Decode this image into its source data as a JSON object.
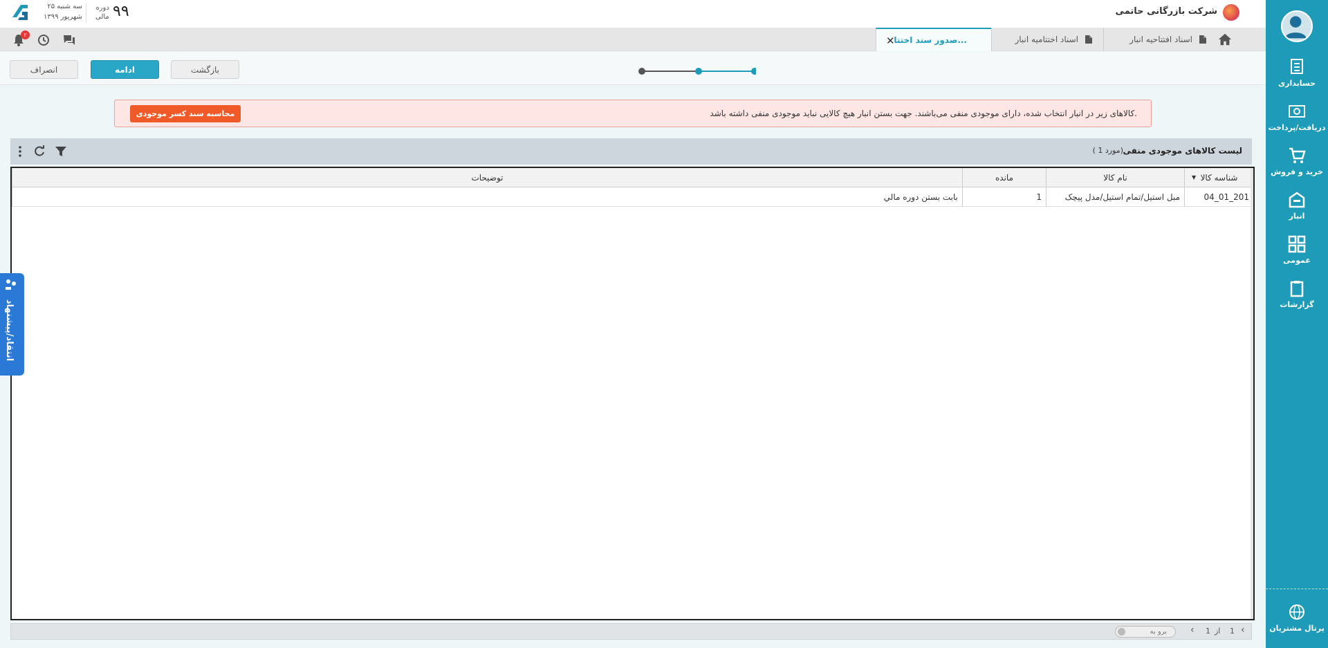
{
  "colors": {
    "accent": "#1d9bb8",
    "alert_bg": "#fde6e4",
    "alert_button": "#f05a28",
    "feedback": "#2b79d6"
  },
  "sidebar": {
    "items": [
      {
        "label": "حسابداری",
        "icon": "accounting-icon"
      },
      {
        "label": "دریافت/پرداخت",
        "icon": "cash-icon"
      },
      {
        "label": "خرید و فروش",
        "icon": "cart-icon"
      },
      {
        "label": "انبار",
        "icon": "warehouse-icon"
      },
      {
        "label": "عمومی",
        "icon": "apps-icon"
      },
      {
        "label": "گزارشات",
        "icon": "clipboard-icon"
      }
    ],
    "portal": {
      "label": "پرتال مشتریان",
      "icon": "globe-icon"
    }
  },
  "header": {
    "company": "شرکت بازرگانی حاتمی",
    "period_number": "۹۹",
    "period_label_1": "دوره",
    "period_label_2": "مالی",
    "date_line_1": "سه شنبه ۲۵",
    "date_line_2": "شهریور ۱۳۹۹",
    "notification_count": "۲"
  },
  "tabs": [
    {
      "label": "اسناد افتتاحیه انبار",
      "icon": "document-add-icon"
    },
    {
      "label": "اسناد اختتامیه انبار",
      "icon": "document-add-icon"
    },
    {
      "label": "صدور سند اختتا...",
      "active": true
    }
  ],
  "actions": {
    "cancel": "انصراف",
    "continue": "ادامه",
    "back": "بازگشت"
  },
  "stepper": {
    "steps": 3,
    "current": 1
  },
  "alert": {
    "message": "کالاهای زیر در انبار انتخاب شده، دارای موجودی منفی می‌باشند. جهت بستن انبار هیچ کالایی نباید موجودی منفی داشته باشد.",
    "button": "محاسبه سند کسر موجودی"
  },
  "list": {
    "title": "لیست کالاهای موجودی منفی",
    "count_text": "( 1 مورد)"
  },
  "grid": {
    "columns": [
      "شناسه کالا",
      "نام کالا",
      "مانده",
      "توضیحات"
    ],
    "rows": [
      [
        "04_01_201",
        "مبل استیل/تمام استیل/مدل پیچک",
        "1",
        "بابت بستن دوره مالي"
      ]
    ]
  },
  "pager": {
    "page": "1",
    "of_label": "از",
    "total": "1",
    "goto_placeholder": "برو به"
  },
  "feedback": {
    "label": "انتقاد/پیشنهاد"
  }
}
